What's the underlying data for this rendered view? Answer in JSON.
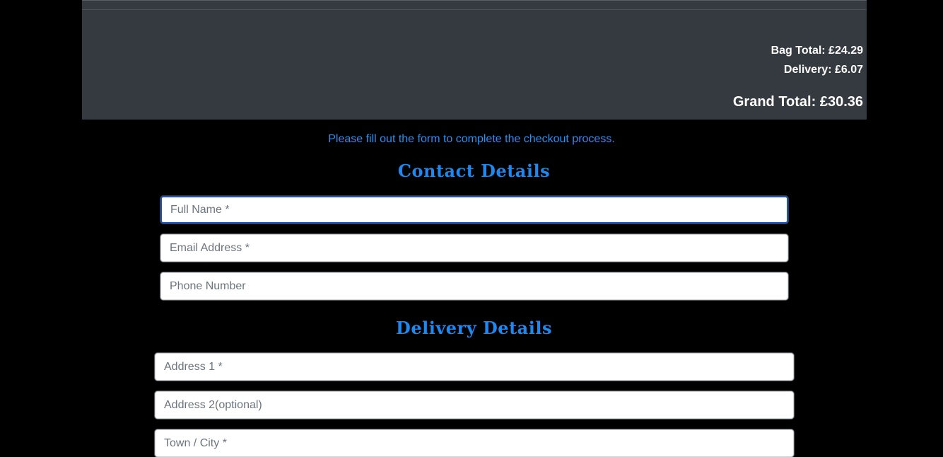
{
  "summary": {
    "bag_total": "Bag Total: £24.29",
    "delivery": "Delivery: £6.07",
    "grand_total": "Grand Total: £30.36"
  },
  "checkout": {
    "instructions": "Please fill out the form to complete the checkout process."
  },
  "contact": {
    "heading": "Contact Details",
    "full_name_placeholder": "Full Name *",
    "email_placeholder": "Email Address *",
    "phone_placeholder": "Phone Number"
  },
  "delivery_details": {
    "heading": "Delivery Details",
    "address1_placeholder": "Address 1 *",
    "address2_placeholder": "Address 2(optional)",
    "town_placeholder": "Town / City *"
  },
  "colors": {
    "page_background": "#000000",
    "summary_panel": "#353a40",
    "accent_blue": "#1e88ee",
    "focus_border": "#1c55b5"
  }
}
